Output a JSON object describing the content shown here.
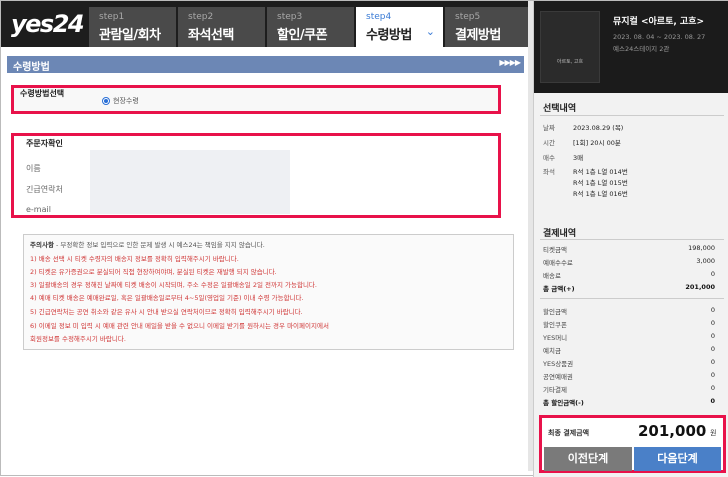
{
  "header": {
    "logo": "yes24",
    "steps": [
      {
        "num": "step1",
        "label": "관람일/회차"
      },
      {
        "num": "step2",
        "label": "좌석선택"
      },
      {
        "num": "step3",
        "label": "할인/쿠폰"
      },
      {
        "num": "step4",
        "label": "수령방법",
        "active": true
      },
      {
        "num": "step5",
        "label": "결제방법"
      }
    ]
  },
  "section": {
    "title": "수령방법",
    "arrows": "▶▶▶▶"
  },
  "receive": {
    "heading": "수령방법선택",
    "option_label": "현장수령",
    "selected": true
  },
  "buyer": {
    "heading": "주문자확인",
    "labels": [
      "이름",
      "긴급연락처",
      "e-mail"
    ]
  },
  "notice": {
    "title": "주의사항",
    "intro": " - 부정확한 정보 입력으로 인한 문제 발생 시 예스24는 책임을 지지 않습니다.",
    "items": [
      "1) 배송 선택 시 티켓 수령자의 배송지 정보를 정확히 입력해주시기 바랍니다.",
      "2) 티켓은 유가증권으로 분실되어 직접 현장하여야며, 분실된 티켓은 재발행 되지 않습니다.",
      "3) 일괄배송의 경우 정해진 날짜에 티켓 배송이 시작되며, 주소 수정은 일괄배송일 2일 전까지 가능합니다.",
      "4) 예매 티켓 배송은 예매완료일, 혹은 일괄배송일로부터 4~5일(영업일 기준) 이내 수령 가능합니다.",
      "5) 긴급연락처는 공연 취소와 같은 유사 시 안내 받으실 연락처이므로 정확히 입력해주시기 바랍니다.",
      "6) 이메일 정보 미 입력 시 예매 관련 안내 메일을 받을 수 없으니 이메일 받기를 원하시는 경우 마이페이지에서",
      "    회원정보를 수정해주시기 바랍니다."
    ]
  },
  "show": {
    "title": "뮤지컬 <아르토, 고흐>",
    "dates": "2023. 08. 04 ~ 2023. 08. 27",
    "venue": "예스24스테이지 2관",
    "poster_text": "아르토, 고흐"
  },
  "selection": {
    "heading": "선택내역",
    "date_label": "날짜",
    "date_value": "2023.08.29 (목)",
    "time_label": "시간",
    "time_value": "[1회] 20시 00분",
    "count_label": "매수",
    "count_value": "3매",
    "seat_label": "좌석",
    "seats": [
      "R석 1층 L열 014번",
      "R석 1층 L열 015번",
      "R석 1층 L열 016번"
    ]
  },
  "payment": {
    "heading": "결제내역",
    "rows1": [
      {
        "label": "티켓금액",
        "value": "198,000"
      },
      {
        "label": "예매수수료",
        "value": "3,000"
      },
      {
        "label": "배송료",
        "value": "0"
      },
      {
        "label": "총 금액(+)",
        "value": "201,000",
        "bold": true
      }
    ],
    "rows2": [
      {
        "label": "할인금액",
        "value": "0"
      },
      {
        "label": "할인쿠폰",
        "value": "0"
      },
      {
        "label": "YES머니",
        "value": "0"
      },
      {
        "label": "예치금",
        "value": "0"
      },
      {
        "label": "YES상품권",
        "value": "0"
      },
      {
        "label": "공연예매권",
        "value": "0"
      },
      {
        "label": "기타결제",
        "value": "0"
      },
      {
        "label": "총 할인금액(-)",
        "value": "0",
        "bold": true
      }
    ]
  },
  "final": {
    "label": "최종 결제금액",
    "amount": "201,000",
    "unit": "원",
    "prev_button": "이전단계",
    "next_button": "다음단계"
  },
  "colors": {
    "highlight": "#e8124a",
    "accent": "#4a80c8",
    "header": "#1d1d1d"
  }
}
